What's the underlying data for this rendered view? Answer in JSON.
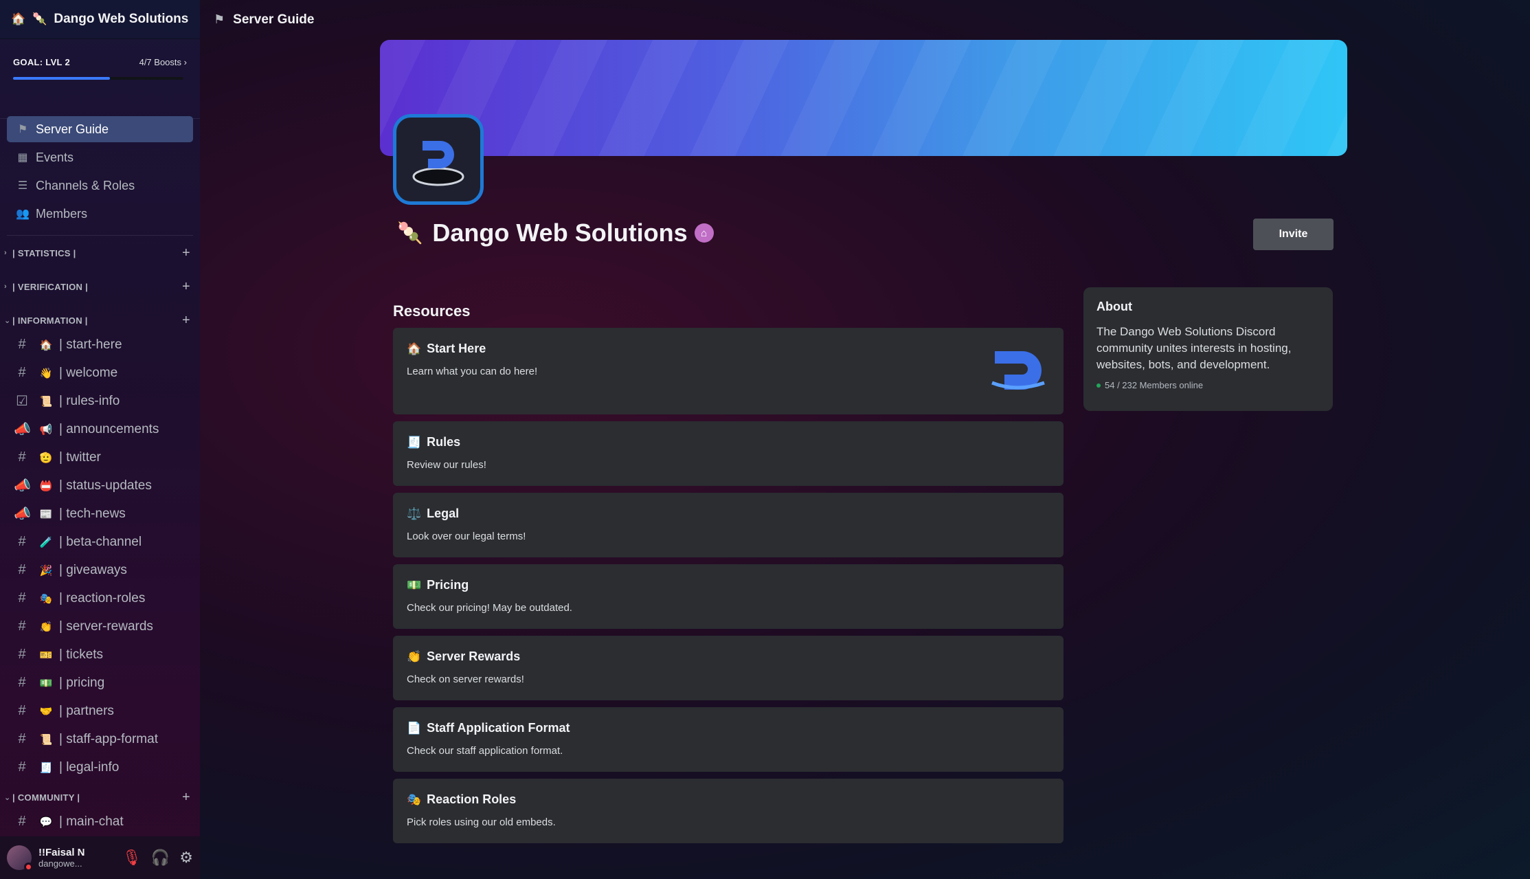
{
  "server": {
    "name": "Dango Web Solutions",
    "boost_goal": "GOAL: LVL 2",
    "boost_count": "4/7 Boosts",
    "boost_progress": 0.57
  },
  "nav": [
    {
      "label": "Server Guide",
      "icon": "signpost-icon"
    },
    {
      "label": "Events",
      "icon": "calendar-icon"
    },
    {
      "label": "Channels & Roles",
      "icon": "list-icon"
    },
    {
      "label": "Members",
      "icon": "members-icon"
    }
  ],
  "categories": {
    "statistics": "| STATISTICS |",
    "verification": "| VERIFICATION |",
    "information": "| INFORMATION |",
    "community": "| COMMUNITY |"
  },
  "channels": [
    {
      "name": "| start-here",
      "emoji": "🏠",
      "icon": "#"
    },
    {
      "name": "| welcome",
      "emoji": "👋",
      "icon": "#"
    },
    {
      "name": "| rules-info",
      "emoji": "📜",
      "icon": "☑"
    },
    {
      "name": "| announcements",
      "emoji": "📢",
      "icon": "📣"
    },
    {
      "name": "| twitter",
      "emoji": "🫡",
      "icon": "#"
    },
    {
      "name": "| status-updates",
      "emoji": "📛",
      "icon": "📣"
    },
    {
      "name": "| tech-news",
      "emoji": "📰",
      "icon": "📣"
    },
    {
      "name": "| beta-channel",
      "emoji": "🧪",
      "icon": "#"
    },
    {
      "name": "| giveaways",
      "emoji": "🎉",
      "icon": "#"
    },
    {
      "name": "| reaction-roles",
      "emoji": "🎭",
      "icon": "#"
    },
    {
      "name": "| server-rewards",
      "emoji": "👏",
      "icon": "#"
    },
    {
      "name": "| tickets",
      "emoji": "🎫",
      "icon": "#"
    },
    {
      "name": "| pricing",
      "emoji": "💵",
      "icon": "#"
    },
    {
      "name": "| partners",
      "emoji": "🤝",
      "icon": "#"
    },
    {
      "name": "| staff-app-format",
      "emoji": "📜",
      "icon": "#"
    },
    {
      "name": "| legal-info",
      "emoji": "🧾",
      "icon": "#"
    }
  ],
  "community_channels": [
    {
      "name": "| main-chat",
      "emoji": "💬",
      "icon": "#"
    }
  ],
  "user": {
    "name": "!!Faisal N",
    "status": "dangowe..."
  },
  "topbar": {
    "title": "Server Guide"
  },
  "invite_label": "Invite",
  "resources": {
    "title": "Resources",
    "items": [
      {
        "emoji": "🏠",
        "title": "Start Here",
        "desc": "Learn what you can do here!"
      },
      {
        "emoji": "🧾",
        "title": "Rules",
        "desc": "Review our rules!"
      },
      {
        "emoji": "⚖️",
        "title": "Legal",
        "desc": "Look over our legal terms!"
      },
      {
        "emoji": "💵",
        "title": "Pricing",
        "desc": "Check our pricing! May be outdated."
      },
      {
        "emoji": "👏",
        "title": "Server Rewards",
        "desc": "Check on server rewards!"
      },
      {
        "emoji": "📄",
        "title": "Staff Application Format",
        "desc": "Check our staff application format."
      },
      {
        "emoji": "🎭",
        "title": "Reaction Roles",
        "desc": "Pick roles using our old embeds."
      }
    ]
  },
  "about": {
    "title": "About",
    "text": "The Dango Web Solutions Discord community unites interests in hosting, websites, bots, and development.",
    "online": "54 / 232 Members online"
  },
  "colors": {
    "accent": "#3b4a78",
    "boost_bar": "#3a7bff",
    "online": "#23a55a"
  }
}
